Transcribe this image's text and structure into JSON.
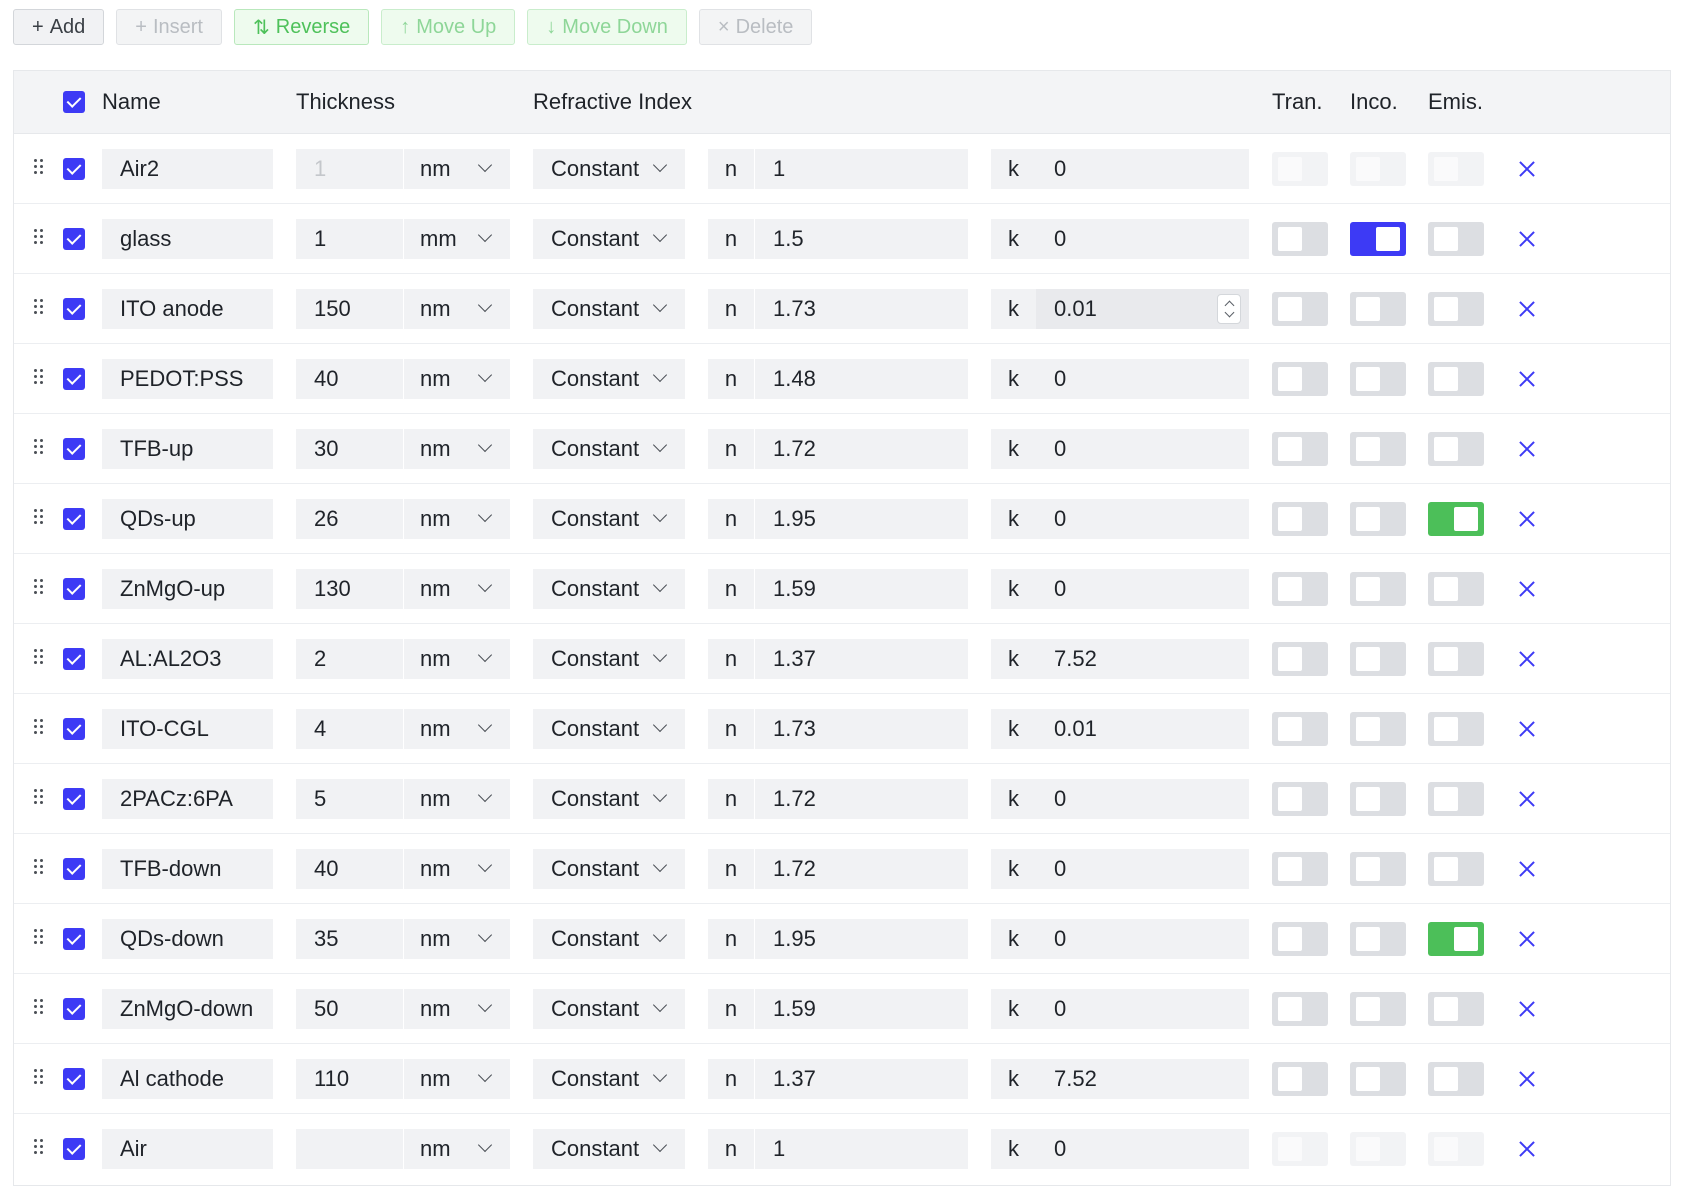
{
  "toolbar": {
    "add": {
      "icon": "plus-icon",
      "label": "Add"
    },
    "insert": {
      "icon": "plus-icon",
      "label": "Insert"
    },
    "reverse": {
      "icon": "swap-vertical-icon",
      "label": "Reverse"
    },
    "move_up": {
      "icon": "arrow-up-icon",
      "label": "Move Up"
    },
    "move_down": {
      "icon": "arrow-down-icon",
      "label": "Move Down"
    },
    "delete": {
      "icon": "close-icon",
      "label": "Delete"
    }
  },
  "header": {
    "name": "Name",
    "thickness": "Thickness",
    "refractive_index": "Refractive Index",
    "tran": "Tran.",
    "inco": "Inco.",
    "emis": "Emis."
  },
  "labels": {
    "n": "n",
    "k": "k"
  },
  "colors": {
    "accent": "#3d3af5",
    "emis_on": "#4cbf59",
    "field_bg": "#f1f2f4"
  },
  "layers": [
    {
      "name": "Air2",
      "thickness": "1",
      "unit": "nm",
      "model": "Constant",
      "n": "1",
      "k": "0",
      "tran": false,
      "inco": false,
      "emis": false,
      "boundary": true
    },
    {
      "name": "glass",
      "thickness": "1",
      "unit": "mm",
      "model": "Constant",
      "n": "1.5",
      "k": "0",
      "tran": false,
      "inco": true,
      "emis": false
    },
    {
      "name": "ITO anode",
      "thickness": "150",
      "unit": "nm",
      "model": "Constant",
      "n": "1.73",
      "k": "0.01",
      "tran": false,
      "inco": false,
      "emis": false,
      "focused_k": true
    },
    {
      "name": "PEDOT:PSS",
      "thickness": "40",
      "unit": "nm",
      "model": "Constant",
      "n": "1.48",
      "k": "0",
      "tran": false,
      "inco": false,
      "emis": false
    },
    {
      "name": "TFB-up",
      "thickness": "30",
      "unit": "nm",
      "model": "Constant",
      "n": "1.72",
      "k": "0",
      "tran": false,
      "inco": false,
      "emis": false
    },
    {
      "name": "QDs-up",
      "thickness": "26",
      "unit": "nm",
      "model": "Constant",
      "n": "1.95",
      "k": "0",
      "tran": false,
      "inco": false,
      "emis": true
    },
    {
      "name": "ZnMgO-up",
      "thickness": "130",
      "unit": "nm",
      "model": "Constant",
      "n": "1.59",
      "k": "0",
      "tran": false,
      "inco": false,
      "emis": false
    },
    {
      "name": "AL:AL2O3",
      "thickness": "2",
      "unit": "nm",
      "model": "Constant",
      "n": "1.37",
      "k": "7.52",
      "tran": false,
      "inco": false,
      "emis": false
    },
    {
      "name": "ITO-CGL",
      "thickness": "4",
      "unit": "nm",
      "model": "Constant",
      "n": "1.73",
      "k": "0.01",
      "tran": false,
      "inco": false,
      "emis": false
    },
    {
      "name": "2PACz:6PA",
      "thickness": "5",
      "unit": "nm",
      "model": "Constant",
      "n": "1.72",
      "k": "0",
      "tran": false,
      "inco": false,
      "emis": false
    },
    {
      "name": "TFB-down",
      "thickness": "40",
      "unit": "nm",
      "model": "Constant",
      "n": "1.72",
      "k": "0",
      "tran": false,
      "inco": false,
      "emis": false
    },
    {
      "name": "QDs-down",
      "thickness": "35",
      "unit": "nm",
      "model": "Constant",
      "n": "1.95",
      "k": "0",
      "tran": false,
      "inco": false,
      "emis": true
    },
    {
      "name": "ZnMgO-down",
      "thickness": "50",
      "unit": "nm",
      "model": "Constant",
      "n": "1.59",
      "k": "0",
      "tran": false,
      "inco": false,
      "emis": false
    },
    {
      "name": "Al cathode",
      "thickness": "110",
      "unit": "nm",
      "model": "Constant",
      "n": "1.37",
      "k": "7.52",
      "tran": false,
      "inco": false,
      "emis": false
    },
    {
      "name": "Air",
      "thickness": "",
      "unit": "nm",
      "model": "Constant",
      "n": "1",
      "k": "0",
      "tran": false,
      "inco": false,
      "emis": false,
      "boundary": true
    }
  ]
}
